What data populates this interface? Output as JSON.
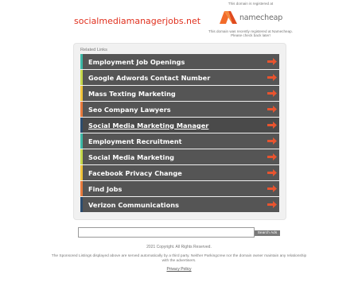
{
  "header": {
    "domain": "socialmediamanagerjobs.net",
    "registrar_top": "This domain is registered at",
    "registrar_brand": "namecheap",
    "registrar_note": "This domain was recently registered at Namecheap. Please check back later!"
  },
  "panel": {
    "heading": "Related Links",
    "links": [
      {
        "label": "Employment Job Openings",
        "bar_color": "#3bb8a6"
      },
      {
        "label": "Google Adwords Contact Number",
        "bar_color": "#c6d94a"
      },
      {
        "label": "Mass Texting Marketing",
        "bar_color": "#f1c43a"
      },
      {
        "label": "Seo Company Lawyers",
        "bar_color": "#e87a3c"
      },
      {
        "label": "Social Media Marketing Manager",
        "bar_color": "#2b4c6e"
      },
      {
        "label": "Employment Recruitment",
        "bar_color": "#3bb8a6"
      },
      {
        "label": "Social Media Marketing",
        "bar_color": "#c6d94a"
      },
      {
        "label": "Facebook Privacy Change",
        "bar_color": "#f1c43a"
      },
      {
        "label": "Find Jobs",
        "bar_color": "#e87a3c"
      },
      {
        "label": "Verizon Communications",
        "bar_color": "#2b4c6e"
      }
    ],
    "hovered_index": 4,
    "arrow_color": "#e8542f"
  },
  "search": {
    "value": "",
    "button_label": "Search Ads"
  },
  "footer": {
    "copyright": "2021 Copyright. All Rights Reserved.",
    "disclaimer": "The Sponsored Listings displayed above are served automatically by a third party. Neither Parkingcrew nor the domain owner maintain any relationship with the advertisers.",
    "privacy": "Privacy Policy"
  }
}
